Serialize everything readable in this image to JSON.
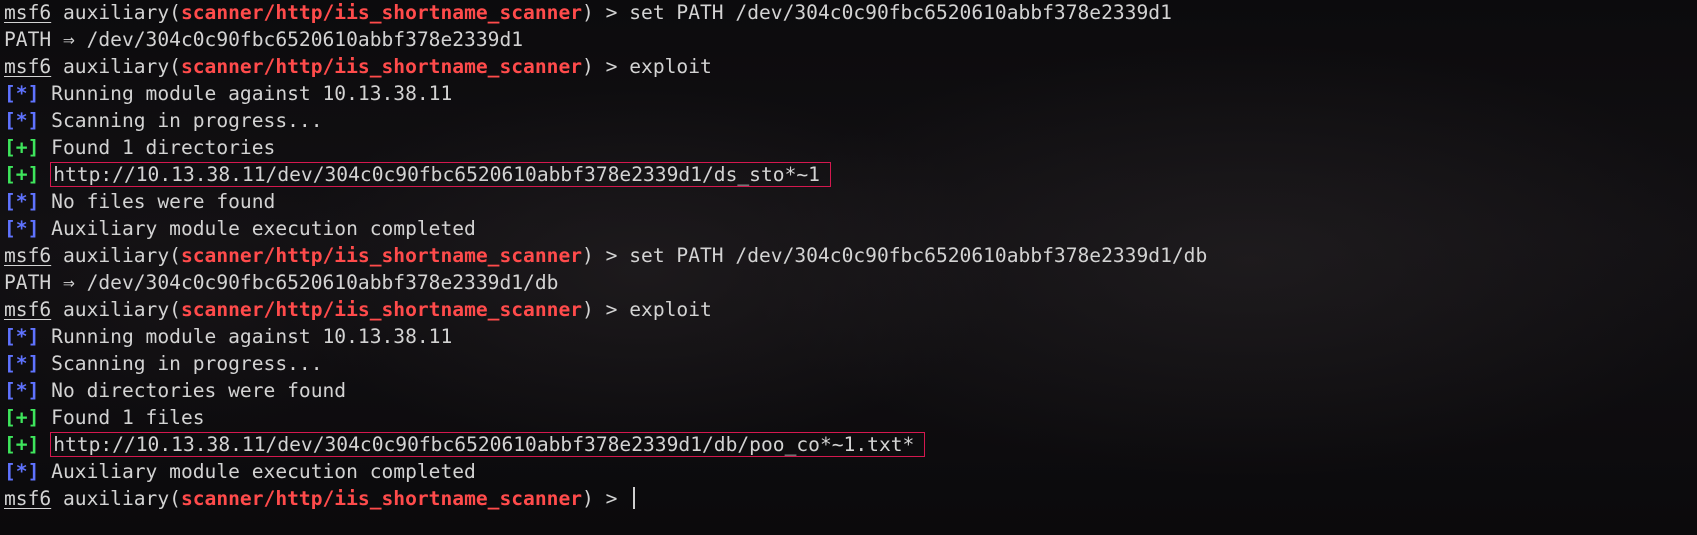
{
  "prompt": {
    "name": "msf6",
    "context_open": " auxiliary(",
    "module": "scanner/http/iis_shortname_scanner",
    "context_close": ") > "
  },
  "tags": {
    "info": "[*]",
    "good": "[+]"
  },
  "lines": {
    "l0": {
      "cmd": "set PATH /dev/304c0c90fbc6520610abbf378e2339d1"
    },
    "l1": {
      "text": "PATH ⇒ /dev/304c0c90fbc6520610abbf378e2339d1"
    },
    "l2": {
      "cmd": "exploit"
    },
    "l3": {
      "text": " Running module against 10.13.38.11"
    },
    "l4": {
      "text": " Scanning in progress..."
    },
    "l5": {
      "text": " Found 1 directories"
    },
    "l6": {
      "text": "http://10.13.38.11/dev/304c0c90fbc6520610abbf378e2339d1/ds_sto*~1"
    },
    "l7": {
      "text": " No files were found"
    },
    "l8": {
      "text": " Auxiliary module execution completed"
    },
    "l9": {
      "cmd": "set PATH /dev/304c0c90fbc6520610abbf378e2339d1/db"
    },
    "l10": {
      "text": "PATH ⇒ /dev/304c0c90fbc6520610abbf378e2339d1/db"
    },
    "l11": {
      "cmd": "exploit"
    },
    "l12": {
      "text": " Running module against 10.13.38.11"
    },
    "l13": {
      "text": " Scanning in progress..."
    },
    "l14": {
      "text": " No directories were found"
    },
    "l15": {
      "text": " Found 1 files"
    },
    "l16": {
      "text": "http://10.13.38.11/dev/304c0c90fbc6520610abbf378e2339d1/db/poo_co*~1.txt*"
    },
    "l17": {
      "text": " Auxiliary module execution completed"
    },
    "l18": {
      "cmd": ""
    }
  }
}
